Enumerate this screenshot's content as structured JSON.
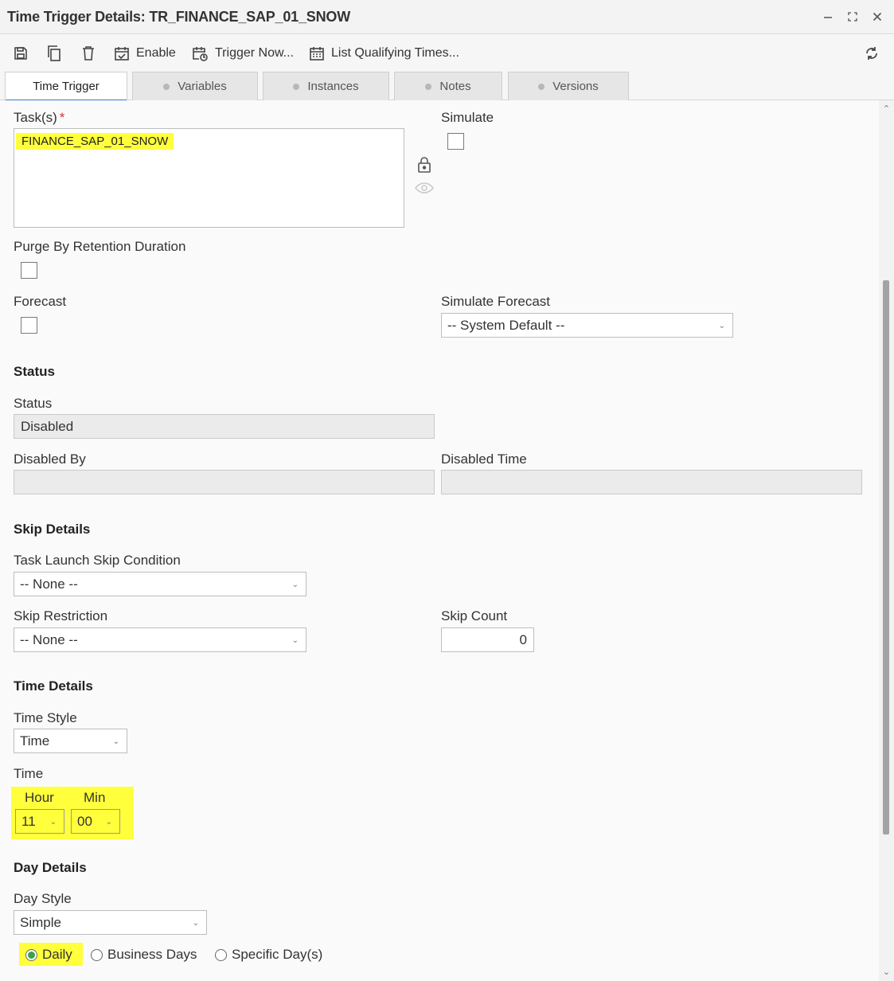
{
  "window": {
    "title": "Time Trigger Details: TR_FINANCE_SAP_01_SNOW",
    "controls": [
      "minimize-icon",
      "maximize-icon",
      "close-icon"
    ]
  },
  "toolbar": {
    "save_icon": "save-icon",
    "copy_icon": "copy-icon",
    "delete_icon": "trash-icon",
    "enable_label": "Enable",
    "trigger_now_label": "Trigger Now...",
    "list_qualifying_label": "List Qualifying Times...",
    "refresh_icon": "refresh-icon"
  },
  "tabs": [
    {
      "label": "Time Trigger",
      "active": true
    },
    {
      "label": "Variables",
      "active": false
    },
    {
      "label": "Instances",
      "active": false
    },
    {
      "label": "Notes",
      "active": false
    },
    {
      "label": "Versions",
      "active": false
    }
  ],
  "form": {
    "tasks_label": "Task(s)",
    "tasks_required": "*",
    "tasks_value": "FINANCE_SAP_01_SNOW",
    "simulate_label": "Simulate",
    "simulate_checked": false,
    "purge_label": "Purge By Retention Duration",
    "purge_checked": false,
    "forecast_label": "Forecast",
    "forecast_checked": false,
    "simulate_forecast_label": "Simulate Forecast",
    "simulate_forecast_value": "-- System Default --",
    "status_section": "Status",
    "status_label": "Status",
    "status_value": "Disabled",
    "disabled_by_label": "Disabled By",
    "disabled_by_value": "",
    "disabled_time_label": "Disabled Time",
    "disabled_time_value": "",
    "skip_section": "Skip Details",
    "skip_condition_label": "Task Launch Skip Condition",
    "skip_condition_value": "-- None --",
    "skip_restriction_label": "Skip Restriction",
    "skip_restriction_value": "-- None --",
    "skip_count_label": "Skip Count",
    "skip_count_value": "0",
    "time_section": "Time Details",
    "time_style_label": "Time Style",
    "time_style_value": "Time",
    "time_label": "Time",
    "hour_label": "Hour",
    "hour_value": "11",
    "min_label": "Min",
    "min_value": "00",
    "day_section": "Day Details",
    "day_style_label": "Day Style",
    "day_style_value": "Simple",
    "day_options": [
      {
        "label": "Daily",
        "selected": true
      },
      {
        "label": "Business Days",
        "selected": false
      },
      {
        "label": "Specific Day(s)",
        "selected": false
      }
    ]
  },
  "colors": {
    "highlight": "#ffff3c",
    "tab_accent": "#3a7bd5",
    "required": "#d9302c",
    "radio_selected": "#3aa24a"
  }
}
